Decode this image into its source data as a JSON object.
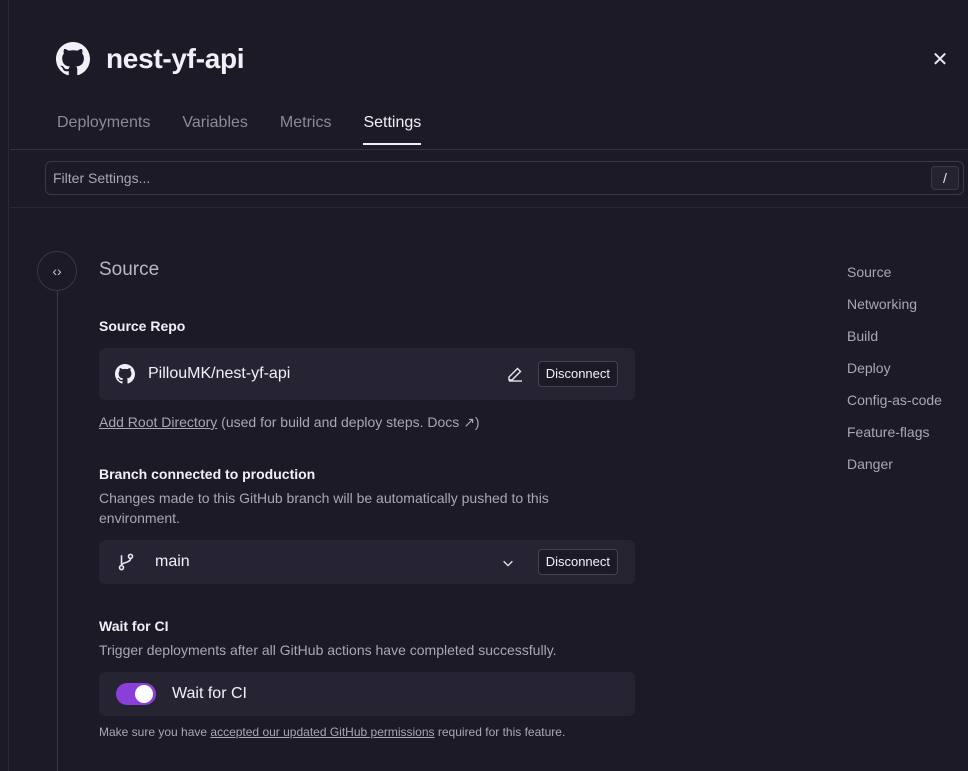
{
  "service": {
    "title": "nest-yf-api",
    "icon": "github-icon"
  },
  "close_icon": "close-icon",
  "tabs": [
    {
      "label": "Deployments",
      "active": false
    },
    {
      "label": "Variables",
      "active": false
    },
    {
      "label": "Metrics",
      "active": false
    },
    {
      "label": "Settings",
      "active": true
    }
  ],
  "filter": {
    "placeholder": "Filter Settings...",
    "shortcut": "/"
  },
  "section": {
    "title": "Source",
    "icon": "code-icon"
  },
  "source_repo": {
    "label": "Source Repo",
    "repo": "PillouMK/nest-yf-api",
    "disconnect": "Disconnect",
    "add_root_link": "Add Root Directory",
    "add_root_hint": " (used for build and deploy steps. Docs ↗)"
  },
  "branch": {
    "label": "Branch connected to production",
    "description": "Changes made to this GitHub branch will be automatically pushed to this environment.",
    "value": "main",
    "disconnect": "Disconnect"
  },
  "wait_ci": {
    "label": "Wait for CI",
    "description": "Trigger deployments after all GitHub actions have completed successfully.",
    "toggle_label": "Wait for CI",
    "enabled": true,
    "note_prefix": "Make sure you have ",
    "note_link": "accepted our updated GitHub permissions",
    "note_suffix": " required for this feature."
  },
  "right_nav": [
    "Source",
    "Networking",
    "Build",
    "Deploy",
    "Config-as-code",
    "Feature-flags",
    "Danger"
  ],
  "colors": {
    "background": "#1c1a26",
    "card": "#262432",
    "toggle_on": "#8b3fd9"
  }
}
